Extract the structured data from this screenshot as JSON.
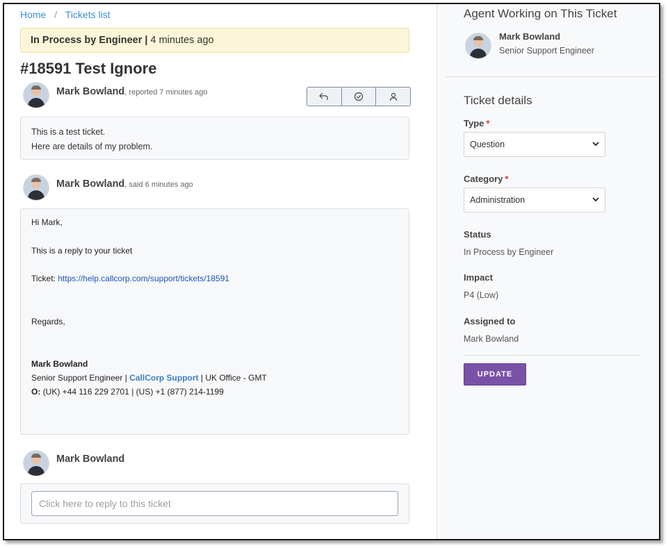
{
  "breadcrumb": {
    "home": "Home",
    "tickets": "Tickets list"
  },
  "status_bar": {
    "status": "In Process by Engineer |",
    "time": "4 minutes ago"
  },
  "ticket": {
    "title": "#18591 Test Ignore"
  },
  "original_post": {
    "author": "Mark Bowland",
    "meta": ", reported 7 minutes ago",
    "body_line1": "This is a test ticket.",
    "body_line2": "Here are details of my problem."
  },
  "actions": {
    "icons": [
      "reply-icon",
      "resolve-check-icon",
      "assign-user-icon"
    ]
  },
  "reply": {
    "author": "Mark Bowland",
    "meta": ", said 6 minutes ago",
    "greeting": "Hi Mark,",
    "line1": "This is a reply to your ticket",
    "ticket_label": "Ticket:",
    "ticket_link": "https://help.callcorp.com/support/tickets/18591",
    "regards": "Regards,",
    "sig_name": "Mark Bowland",
    "sig_title": "Senior Support Engineer |",
    "sig_company": "CallCorp Support",
    "sig_office": "| UK Office - GMT",
    "sig_phone_label": "O:",
    "sig_phone": "(UK) +44 116 229 2701 | (US) +1 (877) 214-1199"
  },
  "composer": {
    "author": "Mark Bowland",
    "placeholder": "Click here to reply to this ticket"
  },
  "sidebar": {
    "agent_heading": "Agent Working on This Ticket",
    "agent_name": "Mark Bowland",
    "agent_role": "Senior Support Engineer",
    "details_heading": "Ticket details",
    "type_label": "Type",
    "type_value": "Question",
    "category_label": "Category",
    "category_value": "Administration",
    "required_mark": "*",
    "status_label": "Status",
    "status_value": "In Process by Engineer",
    "impact_label": "Impact",
    "impact_value": "P4 (Low)",
    "assigned_label": "Assigned to",
    "assigned_value": "Mark Bowland",
    "update_label": "UPDATE"
  },
  "colors": {
    "accent": "#7952a8",
    "link": "#3b8ed4",
    "status_bg": "#fcf5d9"
  }
}
